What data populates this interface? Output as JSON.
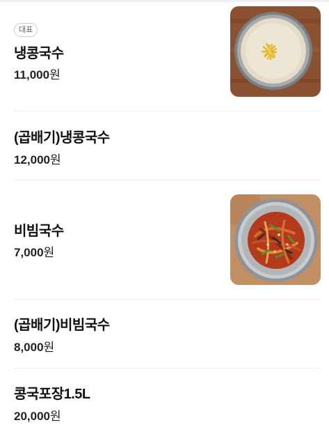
{
  "menu": {
    "items": [
      {
        "badge": "대표",
        "name": "냉콩국수",
        "price_number": "11,000",
        "price_unit": "원",
        "image": "bowl-of-cold-soybean-noodle-soup"
      },
      {
        "name": "(곱배기)냉콩국수",
        "price_number": "12,000",
        "price_unit": "원"
      },
      {
        "name": "비빔국수",
        "price_number": "7,000",
        "price_unit": "원",
        "image": "bowl-of-spicy-mixed-noodles"
      },
      {
        "name": "(곱배기)비빔국수",
        "price_number": "8,000",
        "price_unit": "원"
      },
      {
        "name": "콩국포장1.5L",
        "price_number": "20,000",
        "price_unit": "원"
      }
    ]
  }
}
